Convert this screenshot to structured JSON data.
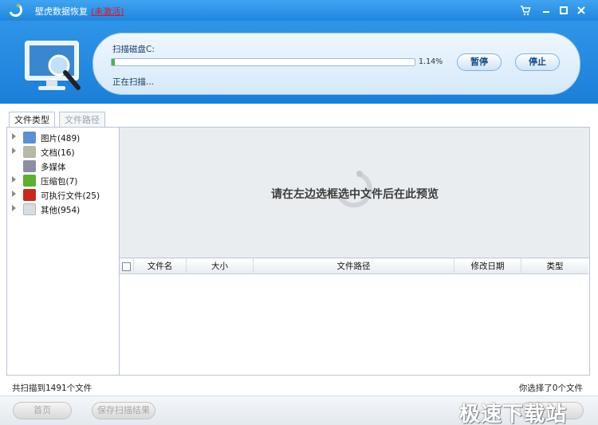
{
  "window": {
    "title": "壁虎数据恢复",
    "badge": "(未激活)"
  },
  "scan": {
    "label": "扫描磁盘C:",
    "progress_percent": 1.14,
    "progress_text": "1.14%",
    "status": "正在扫描...",
    "pause_label": "暂停",
    "stop_label": "停止"
  },
  "tabs": [
    {
      "label": "文件类型",
      "active": true
    },
    {
      "label": "文件路径",
      "active": false
    }
  ],
  "tree": [
    {
      "label": "图片(489)",
      "icon": "image-icon",
      "color": "#5b8fd6",
      "expandable": true
    },
    {
      "label": "文档(16)",
      "icon": "document-icon",
      "color": "#b9b9a3",
      "expandable": true
    },
    {
      "label": "多媒体",
      "icon": "media-icon",
      "color": "#8c8ca8",
      "expandable": false
    },
    {
      "label": "压缩包(7)",
      "icon": "archive-icon",
      "color": "#5bb02e",
      "expandable": true
    },
    {
      "label": "可执行文件(25)",
      "icon": "executable-icon",
      "color": "#c8281e",
      "expandable": true
    },
    {
      "label": "其他(954)",
      "icon": "other-file-icon",
      "color": "#d8dde2",
      "expandable": true
    }
  ],
  "preview": {
    "hint": "请在左边选框选中文件后在此预览"
  },
  "table": {
    "columns": [
      "文件名",
      "大小",
      "文件路径",
      "修改日期",
      "类型"
    ]
  },
  "footer": {
    "scanned_text": "共扫描到1491个文件",
    "selected_text": "你选择了0个文件",
    "home_label": "首页",
    "save_label": "保存扫描结果",
    "watermark": "极速下载站"
  },
  "colors": {
    "titlebar": "#1f86e0",
    "progress": "#4fb044",
    "badge": "#e0162b"
  }
}
